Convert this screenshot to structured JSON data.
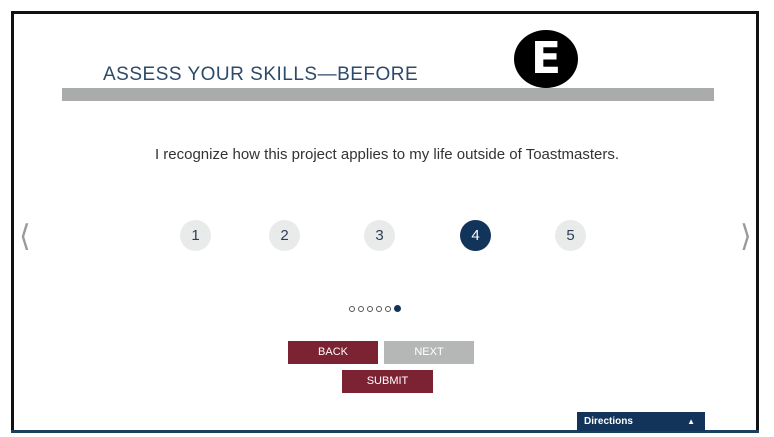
{
  "header": {
    "title": "ASSESS YOUR SKILLS—BEFORE",
    "badge_letter": "E"
  },
  "question": {
    "text": "I recognize how this project applies to my life outside of Toastmasters."
  },
  "navigation": {
    "prev_glyph": "⟨",
    "next_glyph": "⟩"
  },
  "rating": {
    "options": [
      "1",
      "2",
      "3",
      "4",
      "5"
    ],
    "selected": "4"
  },
  "progress": {
    "total_dots": 6,
    "current_dot": 6
  },
  "buttons": {
    "back_label": "BACK",
    "next_label": "NEXT",
    "submit_label": "SUBMIT",
    "next_enabled": false
  },
  "directions": {
    "label": "Directions",
    "toggle_icon": "caret-up-icon"
  },
  "colors": {
    "primary_navy": "#12335a",
    "maroon": "#7c2333",
    "disabled_gray": "#b5b7b6",
    "header_bar_gray": "#a9acaa"
  }
}
